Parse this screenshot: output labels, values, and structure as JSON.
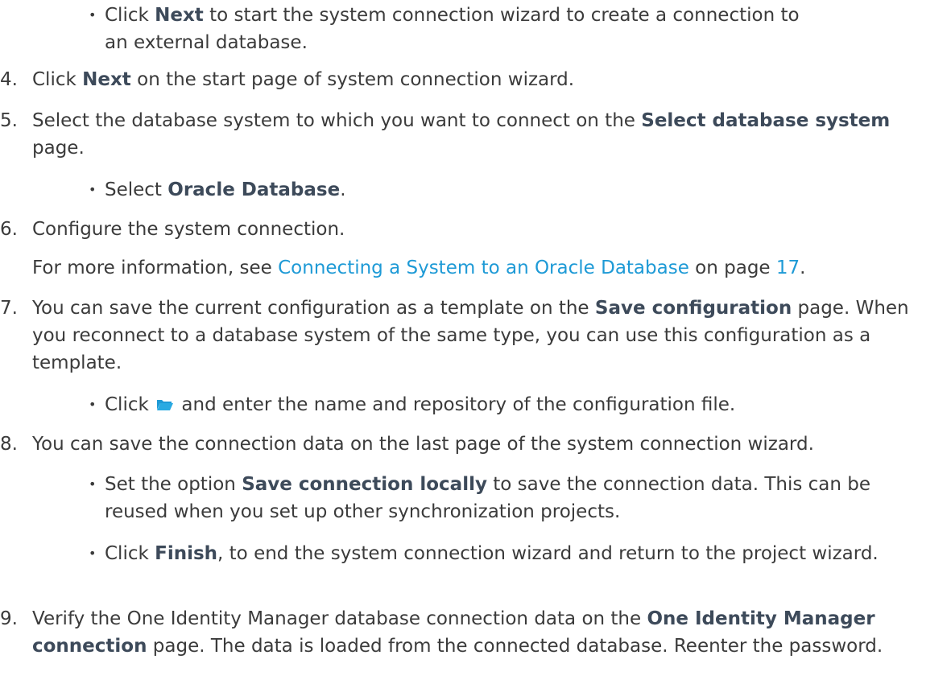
{
  "continuation_bullet": {
    "pre": "Click ",
    "bold": "Next",
    "post": " to start the system connection wizard to create a connection to an external database."
  },
  "steps": [
    {
      "num": "4.",
      "pre": "Click ",
      "bold": "Next",
      "post": " on the start page of system connection wizard."
    },
    {
      "num": "5.",
      "pre": "Select the database system to which you want to connect on the ",
      "bold": "Select database system",
      "post": " page."
    },
    {
      "num": "6.",
      "text": "Configure the system connection."
    },
    {
      "num": "7.",
      "pre": "You can save the current configuration as a template on the ",
      "bold": "Save configuration",
      "post": " page. When you reconnect to a database system of the same type, you can use this configuration as a template."
    },
    {
      "num": "8.",
      "text": "You can save the connection data on the last page of the system connection wizard."
    },
    {
      "num": "9.",
      "pre": "Verify the One Identity Manager database connection data on the ",
      "bold": "One Identity Manager connection",
      "post": " page. The data is loaded from the connected database. Reenter the password."
    }
  ],
  "step5_sub": {
    "pre": "Select ",
    "bold": "Oracle Database",
    "post": "."
  },
  "step6_info": {
    "pre": "For more information, see ",
    "link": "Connecting a System to an Oracle Database",
    "mid": " on page ",
    "page": "17",
    "post": "."
  },
  "step7_sub": {
    "pre": "Click ",
    "icon": "folder-open-icon",
    "post": " and enter the name and repository of the configuration file."
  },
  "step8_subs": [
    {
      "pre": "Set the option ",
      "bold": "Save connection locally",
      "post": " to save the connection data. This can be reused when you set up other synchronization projects."
    },
    {
      "pre": "Click ",
      "bold": "Finish",
      "post": ", to end the system connection wizard and return to the project wizard."
    }
  ],
  "colors": {
    "text": "#3b3b3b",
    "bold": "#3d4a5a",
    "link": "#1e9ad6",
    "folder": "#1e9ad6"
  }
}
